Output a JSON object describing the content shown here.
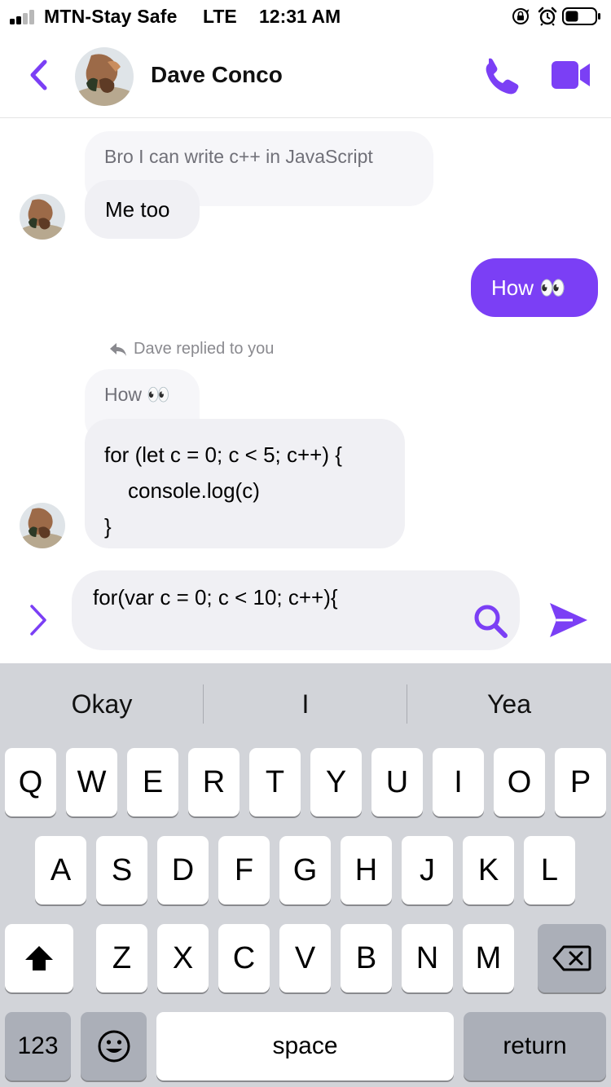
{
  "status_bar": {
    "carrier": "MTN-Stay Safe",
    "network": "LTE",
    "time": "12:31 AM",
    "icons": [
      "signal-icon",
      "orientation-lock-icon",
      "alarm-icon",
      "battery-icon"
    ]
  },
  "header": {
    "contact_name": "Dave Conco",
    "icons": [
      "chevron-left-icon",
      "phone-icon",
      "video-camera-icon"
    ]
  },
  "messages": {
    "quoted_1": "Bro I can write c++ in JavaScript",
    "reply_1": "Me too",
    "sent_1": "How 👀",
    "reply_note": "Dave replied to you",
    "quoted_2": "How 👀",
    "code_reply": {
      "line1": "for (let c = 0; c < 5; c++) {",
      "line2": "console.log(c)",
      "line3": "}"
    }
  },
  "composer": {
    "value": "for(var c = 0; c < 10; c++){",
    "icons": [
      "chevron-right-icon",
      "search-icon",
      "send-icon"
    ]
  },
  "keyboard": {
    "suggestions": [
      "Okay",
      "I",
      "Yea"
    ],
    "row1": [
      "Q",
      "W",
      "E",
      "R",
      "T",
      "Y",
      "U",
      "I",
      "O",
      "P"
    ],
    "row2": [
      "A",
      "S",
      "D",
      "F",
      "G",
      "H",
      "J",
      "K",
      "L"
    ],
    "row3": [
      "Z",
      "X",
      "C",
      "V",
      "B",
      "N",
      "M"
    ],
    "numbers_label": "123",
    "space_label": "space",
    "return_label": "return"
  },
  "colors": {
    "accent": "#7b3ff5",
    "bubble_received": "#f0f0f4",
    "keyboard_bg": "#d2d4d9"
  }
}
